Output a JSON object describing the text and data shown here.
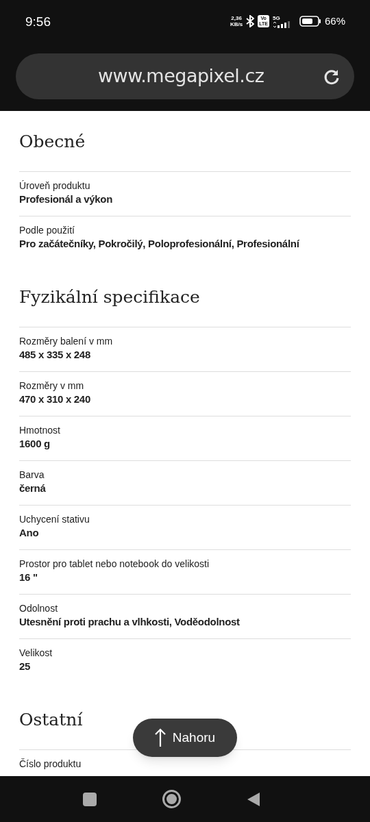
{
  "status_bar": {
    "time": "9:56",
    "network_speed": [
      "2,36",
      "KB/s"
    ],
    "volte_badge": [
      "Vo",
      "LTE"
    ],
    "network_type": "5G",
    "battery": "66%"
  },
  "address_bar": {
    "url": "www.megapixel.cz"
  },
  "sections": [
    {
      "title": "Obecné",
      "rows": [
        {
          "label": "Úroveň produktu",
          "value": "Profesionál a výkon"
        },
        {
          "label": "Podle použití",
          "value": "Pro začátečníky, Pokročilý, Poloprofesionální, Profesionální"
        }
      ]
    },
    {
      "title": "Fyzikální specifikace",
      "rows": [
        {
          "label": "Rozměry balení v mm",
          "value": "485 x 335 x 248"
        },
        {
          "label": "Rozměry v mm",
          "value": "470 x 310 x 240"
        },
        {
          "label": "Hmotnost",
          "value": "1600 g"
        },
        {
          "label": "Barva",
          "value": "černá"
        },
        {
          "label": "Uchycení stativu",
          "value": "Ano"
        },
        {
          "label": "Prostor pro tablet nebo notebook do velikosti",
          "value": "16 \""
        },
        {
          "label": "Odolnost",
          "value": "Utesnění proti prachu a vlhkosti, Voděodolnost"
        },
        {
          "label": "Velikost",
          "value": "25"
        }
      ]
    },
    {
      "title": "Ostatní",
      "rows": [
        {
          "label": "Číslo produktu"
        }
      ]
    }
  ],
  "back_to_top": {
    "label": "Nahoru"
  }
}
